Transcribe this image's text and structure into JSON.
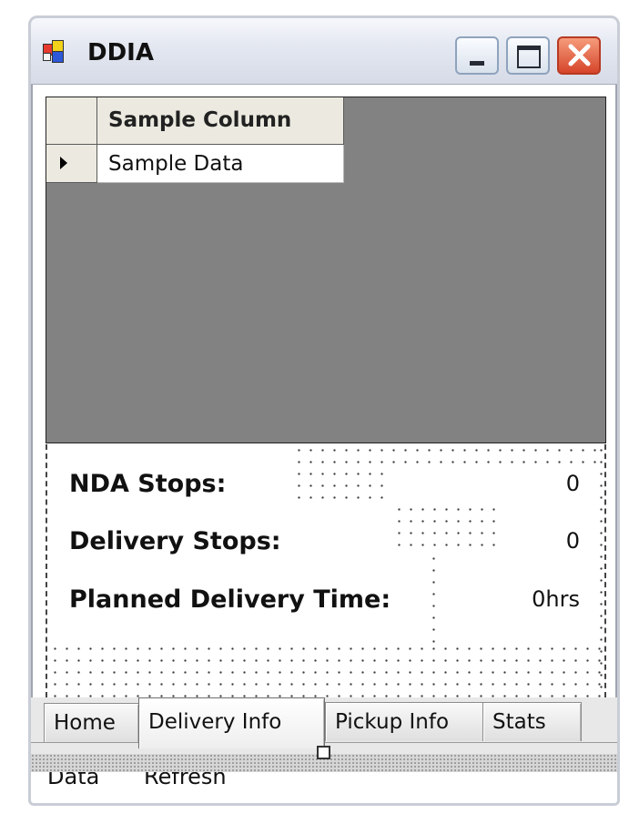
{
  "window": {
    "title": "DDIA"
  },
  "grid": {
    "column_header": "Sample Column",
    "row_value": "Sample Data"
  },
  "stats": {
    "nda_label": "NDA Stops:",
    "nda_value": "0",
    "delivery_label": "Delivery Stops:",
    "delivery_value": "0",
    "planned_label": "Planned Delivery Time:",
    "planned_value": "0hrs"
  },
  "tabs": [
    {
      "label": "Home"
    },
    {
      "label": "Delivery Info"
    },
    {
      "label": "Pickup Info"
    },
    {
      "label": "Stats"
    }
  ],
  "footer": {
    "data_text": "Data",
    "refresh_text": "Refresh"
  },
  "icons": {
    "app": "app-icon",
    "minimize": "minimize-icon",
    "maximize": "maximize-icon",
    "close": "close-icon",
    "row_selector": "row-arrow-icon"
  }
}
